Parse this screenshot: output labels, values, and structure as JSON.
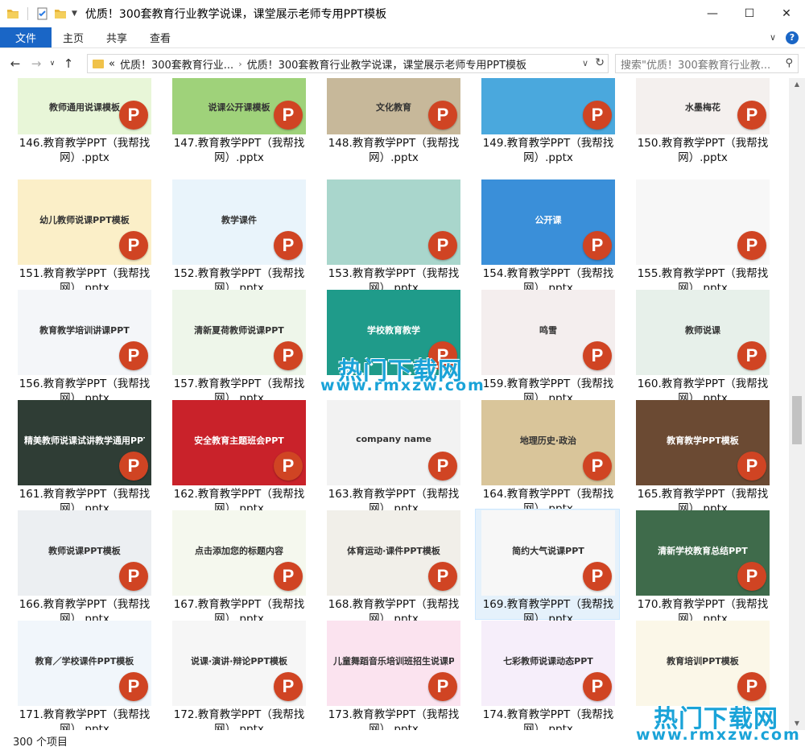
{
  "window": {
    "title": "优质！300套教育行业教学说课，课堂展示老师专用PPT模板",
    "controls": [
      "minimize",
      "maximize",
      "close"
    ]
  },
  "ribbon": {
    "file": "文件",
    "tabs": [
      "主页",
      "共享",
      "查看"
    ]
  },
  "address": {
    "crumbs": [
      "«",
      "优质！300套教育行业...",
      "优质！300套教育行业教学说课，课堂展示老师专用PPT模板"
    ]
  },
  "search": {
    "placeholder": "搜索\"优质！300套教育行业教..."
  },
  "files": [
    {
      "num": 146,
      "line1": "146.教育教学PPT（我帮找",
      "line2": "网）.pptx",
      "thumb": "教师通用说课模板",
      "bg": "#e8f6d8"
    },
    {
      "num": 147,
      "line1": "147.教育教学PPT（我帮找",
      "line2": "网）.pptx",
      "thumb": "说课公开课模板",
      "bg": "#9fd27a"
    },
    {
      "num": 148,
      "line1": "148.教育教学PPT（我帮找",
      "line2": "网）.pptx",
      "thumb": "文化教育",
      "bg": "#c7b89a"
    },
    {
      "num": 149,
      "line1": "149.教育教学PPT（我帮找",
      "line2": "网）.pptx",
      "thumb": "",
      "bg": "#4aa8dd"
    },
    {
      "num": 150,
      "line1": "150.教育教学PPT（我帮找",
      "line2": "网）.pptx",
      "thumb": "水墨梅花",
      "bg": "#f4f0ee"
    },
    {
      "num": 151,
      "line1": "151.教育教学PPT（我帮找",
      "line2": "网）.pptx",
      "thumb": "幼儿教师说课PPT模板",
      "bg": "#fbefc8"
    },
    {
      "num": 152,
      "line1": "152.教育教学PPT（我帮找",
      "line2": "网）.pptx",
      "thumb": "教学课件",
      "bg": "#e9f4fb"
    },
    {
      "num": 153,
      "line1": "153.教育教学PPT（我帮找",
      "line2": "网）.pptx",
      "thumb": "",
      "bg": "#a9d6cc"
    },
    {
      "num": 154,
      "line1": "154.教育教学PPT（我帮找",
      "line2": "网）.pptx",
      "thumb": "公开课",
      "bg": "#3a8fd9"
    },
    {
      "num": 155,
      "line1": "155.教育教学PPT（我帮找",
      "line2": "网）.pptx",
      "thumb": "",
      "bg": "#f7f7f7"
    },
    {
      "num": 156,
      "line1": "156.教育教学PPT（我帮找",
      "line2": "网）.pptx",
      "thumb": "教育教学培训讲课PPT",
      "bg": "#f4f6f9"
    },
    {
      "num": 157,
      "line1": "157.教育教学PPT（我帮找",
      "line2": "网）.pptx",
      "thumb": "清新夏荷教师说课PPT",
      "bg": "#eef6ea"
    },
    {
      "num": 158,
      "line1": "",
      "line2": "",
      "thumb": "学校教育教学",
      "bg": "#1f9b8a"
    },
    {
      "num": 159,
      "line1": "159.教育教学PPT（我帮找",
      "line2": "网）.pptx",
      "thumb": "鸣雪",
      "bg": "#f4eeee"
    },
    {
      "num": 160,
      "line1": "160.教育教学PPT（我帮找",
      "line2": "网）.pptx",
      "thumb": "教师说课",
      "bg": "#e7f0ea"
    },
    {
      "num": 161,
      "line1": "161.教育教学PPT（我帮找",
      "line2": "网）.pptx",
      "thumb": "精美教师说课试讲教学通用PPT",
      "bg": "#2f3d35"
    },
    {
      "num": 162,
      "line1": "162.教育教学PPT（我帮找",
      "line2": "网）.pptx",
      "thumb": "安全教育主题班会PPT",
      "bg": "#c9222a"
    },
    {
      "num": 163,
      "line1": "163.教育教学PPT（我帮找",
      "line2": "网）.pptx",
      "thumb": "company name",
      "bg": "#f2f2f2"
    },
    {
      "num": 164,
      "line1": "164.教育教学PPT（我帮找",
      "line2": "网）.pptx",
      "thumb": "地理历史·政治",
      "bg": "#d9c59a"
    },
    {
      "num": 165,
      "line1": "165.教育教学PPT（我帮找",
      "line2": "网）.pptx",
      "thumb": "教育教学PPT模板",
      "bg": "#6b4a33"
    },
    {
      "num": 166,
      "line1": "166.教育教学PPT（我帮找",
      "line2": "网）.pptx",
      "thumb": "教师说课PPT模板",
      "bg": "#eceff2"
    },
    {
      "num": 167,
      "line1": "167.教育教学PPT（我帮找",
      "line2": "网）.pptx",
      "thumb": "点击添加您的标题内容",
      "bg": "#f5f8ee"
    },
    {
      "num": 168,
      "line1": "168.教育教学PPT（我帮找",
      "line2": "网）.pptx",
      "thumb": "体育运动·课件PPT模板",
      "bg": "#f1efe9"
    },
    {
      "num": 169,
      "line1": "169.教育教学PPT（我帮找",
      "line2": "网）.pptx",
      "thumb": "简约大气说课PPT",
      "bg": "#f7f7f7"
    },
    {
      "num": 170,
      "line1": "170.教育教学PPT（我帮找",
      "line2": "网）.pptx",
      "thumb": "清新学校教育总结PPT",
      "bg": "#3f6b4b"
    },
    {
      "num": 171,
      "line1": "171.教育教学PPT（我帮找",
      "line2": "网）.pptx",
      "thumb": "教育／学校课件PPT模板",
      "bg": "#f1f6fb"
    },
    {
      "num": 172,
      "line1": "172.教育教学PPT（我帮找",
      "line2": "网）.pptx",
      "thumb": "说课·演讲·辩论PPT模板",
      "bg": "#f6f6f6"
    },
    {
      "num": 173,
      "line1": "173.教育教学PPT（我帮找",
      "line2": "网）.pptx",
      "thumb": "儿童舞蹈音乐培训班招生说课PPT",
      "bg": "#fbe3ef"
    },
    {
      "num": 174,
      "line1": "174.教育教学PPT（我帮找",
      "line2": "网）.pptx",
      "thumb": "七彩教师说课动态PPT",
      "bg": "#f6eefa"
    },
    {
      "num": 175,
      "line1": "",
      "line2": "",
      "thumb": "教育培训PPT模板",
      "bg": "#fbf7e8"
    }
  ],
  "status": {
    "count": "300 个项目"
  },
  "watermarks": [
    {
      "title": "热门下载网",
      "url": "www.rmxzw.com"
    },
    {
      "title": "热门下载网",
      "url": "www.rmxzw.com"
    }
  ],
  "colors": {
    "accent": "#1a66c6",
    "ppt": "#d04423",
    "watermark": "#1aa3d8",
    "selection": "#e5f1fb"
  }
}
